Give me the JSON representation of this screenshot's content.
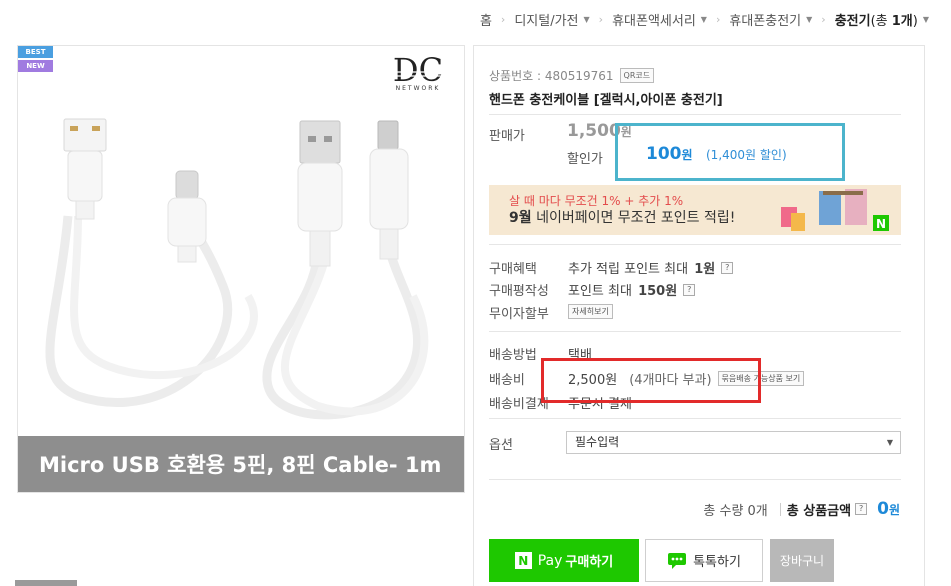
{
  "breadcrumb": {
    "home": "홈",
    "items": [
      "디지털/가전",
      "휴대폰액세서리",
      "휴대폰충전기"
    ],
    "current": "충전기",
    "current_count_prefix": "(총 ",
    "current_count_num": "1개",
    "current_count_suffix": ")"
  },
  "gallery": {
    "badge_best": "BEST",
    "badge_new": "NEW",
    "brand_logo_text": "DC",
    "brand_logo_sub": "NETWORK",
    "caption": "Micro USB 호환용 5핀, 8핀 Cable- 1m"
  },
  "product": {
    "number_label": "상품번호 : 480519761",
    "qr_label": "QR코드",
    "title": "핸드폰 충전케이블 [겔럭시,아이폰 충전기]"
  },
  "price": {
    "sale_price_label": "판매가",
    "original_price": "1,500",
    "original_unit": "원",
    "discount_label": "할인가",
    "discount_price": "100",
    "discount_unit": "원",
    "discount_note": "(1,400원 할인)"
  },
  "banner": {
    "line1": "살 때 마다 무조건 1% + 추가 1%",
    "line2_bold": "9월",
    "line2_rest": " 네이버페이면 무조건 포인트 적립!",
    "npay_mark": "N"
  },
  "benefits": {
    "purchase_benefit_label": "구매혜택",
    "purchase_benefit_prefix": "추가 적립 포인트 최대",
    "purchase_benefit_value": "1원",
    "review_label": "구매평작성",
    "review_prefix": "포인트 최대",
    "review_value": "150원",
    "installment_label": "무이자할부",
    "installment_btn": "자세히보기",
    "help_mark": "?"
  },
  "shipping": {
    "method_label": "배송방법",
    "method_value": "택배",
    "fee_label": "배송비",
    "fee_value": "2,500원",
    "fee_note": "(4개마다 부과)",
    "bundle_btn": "묶음배송 가능상품 보기",
    "payment_label": "배송비결제",
    "payment_value": "주문시 결제"
  },
  "option": {
    "label": "옵션",
    "selected": "필수입력"
  },
  "total": {
    "qty_text": "총 수량 0개",
    "label": "총 상품금액",
    "amount": "0",
    "unit": "원",
    "help_mark": "?"
  },
  "buttons": {
    "npay_text": "Pay",
    "npay_action": "구매하기",
    "npay_mark": "N",
    "talk": "톡톡하기",
    "cart": "장바구니"
  },
  "colors": {
    "npay_green": "#1ec800",
    "price_blue": "#1d89d8",
    "highlight_teal": "#4cb4cc",
    "highlight_red": "#e22a2a"
  }
}
